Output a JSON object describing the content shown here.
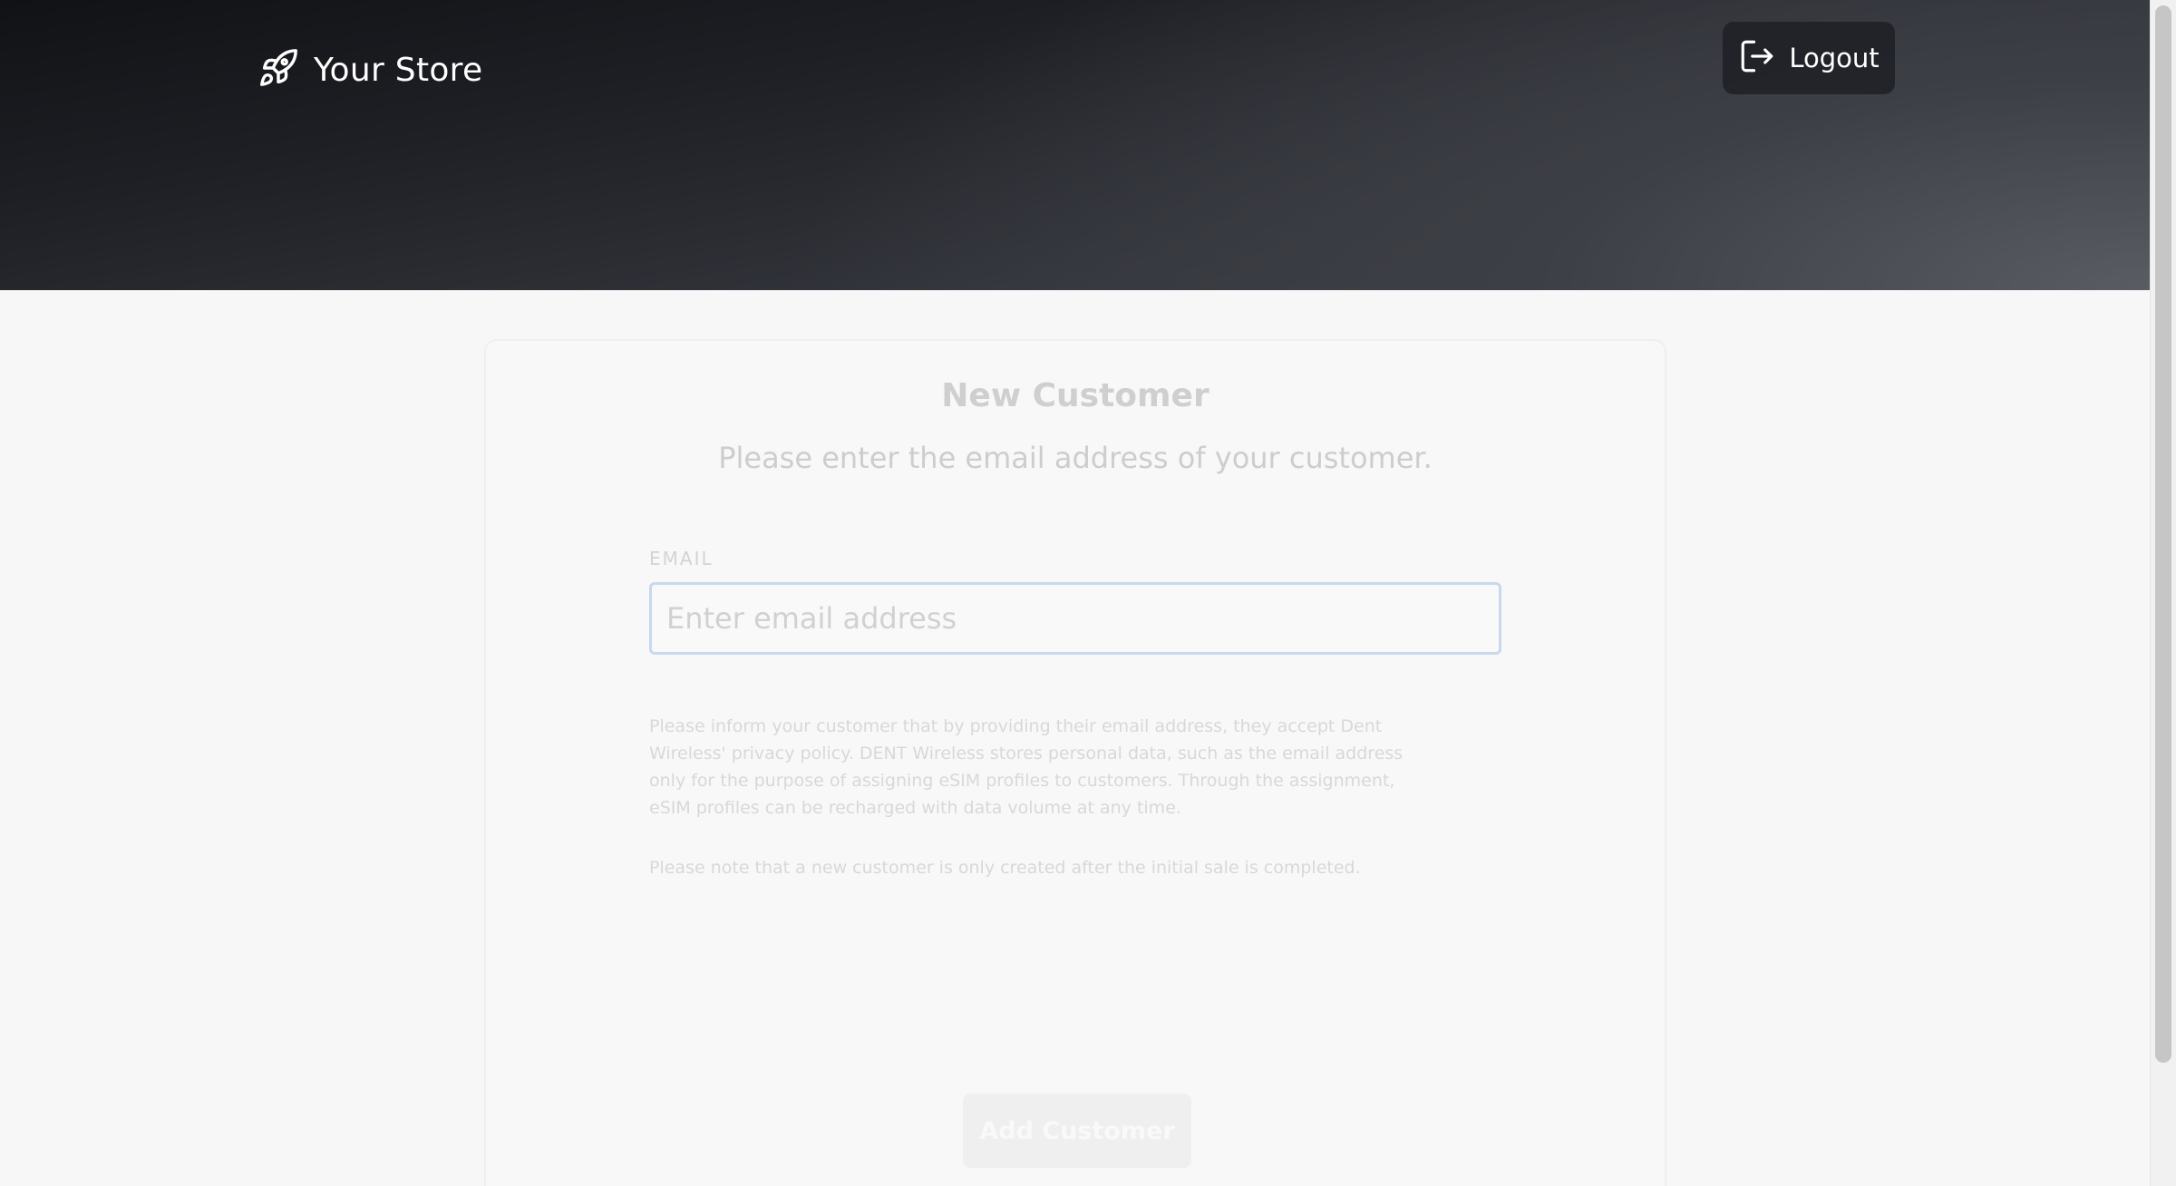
{
  "header": {
    "brand_icon": "rocket-icon",
    "brand_name": "Your Store",
    "logout_icon": "logout-icon",
    "logout_label": "Logout"
  },
  "form": {
    "title": "New Customer",
    "subtitle": "Please enter the email address of your customer.",
    "email_label": "EMAIL",
    "email_placeholder": "Enter email address",
    "email_value": "",
    "privacy_notice": "Please inform your customer that by providing their email address, they accept Dent Wireless' privacy policy. DENT Wireless stores personal data, such as the email address only for the purpose of assigning eSIM profiles to customers. Through the assignment, eSIM profiles can be recharged with data volume at any time.",
    "creation_notice": "Please note that a new customer is only created after the initial sale is completed.",
    "submit_label": "Add Customer"
  },
  "colors": {
    "header_dark": "#111216",
    "header_light": "#5a5c64",
    "input_focus_border": "#c8d8ee",
    "page_background": "#f7f7f7"
  }
}
